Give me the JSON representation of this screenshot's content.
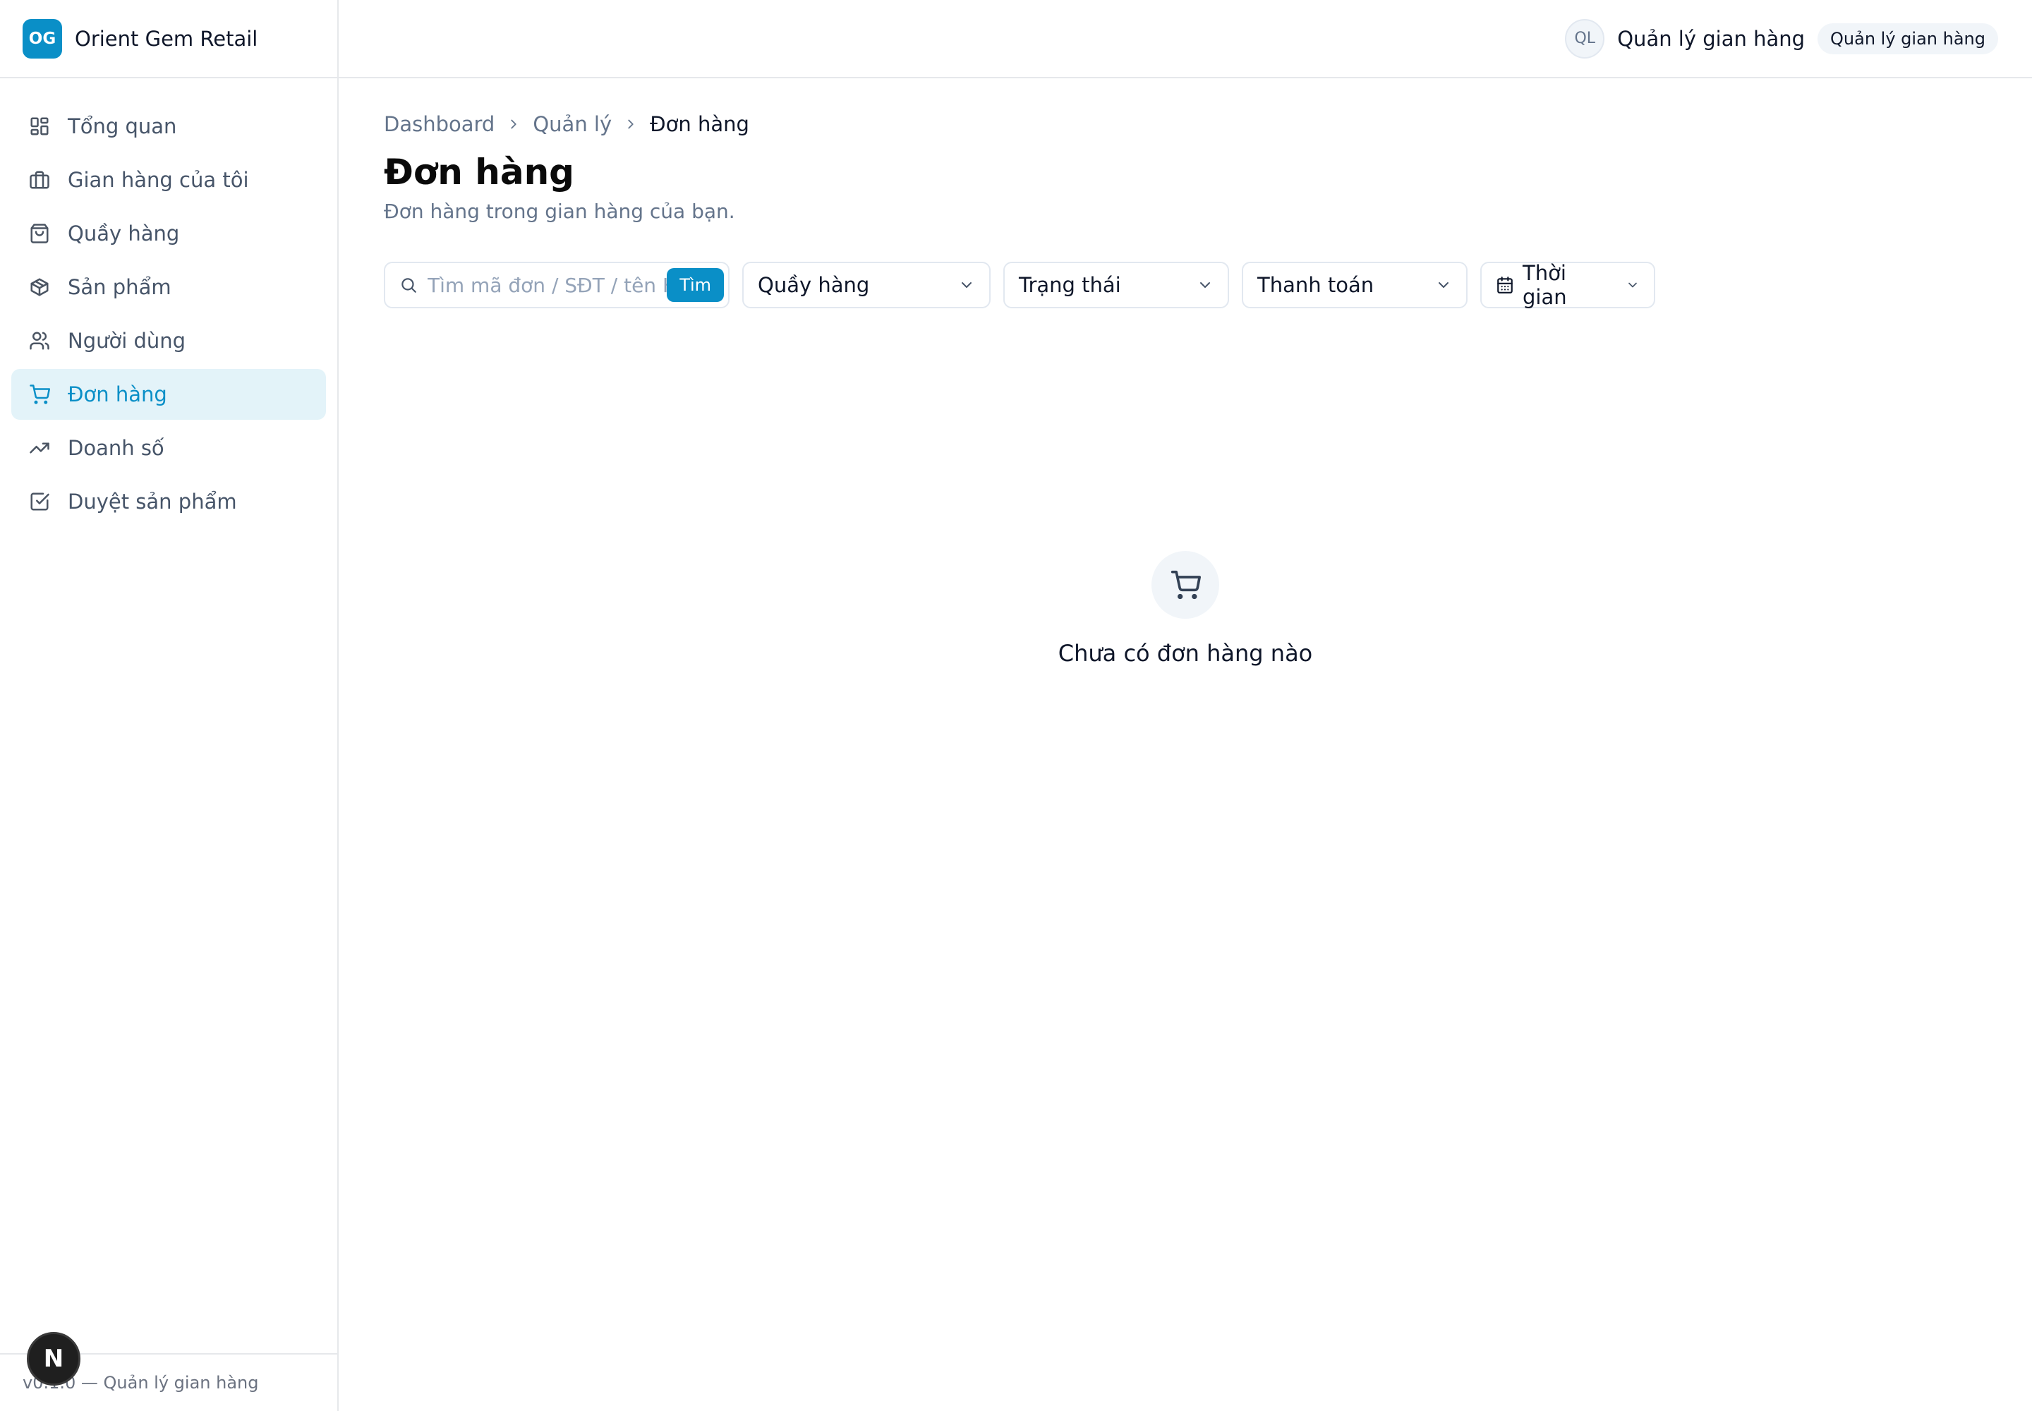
{
  "brand": {
    "logo_text": "OG",
    "name": "Orient Gem Retail"
  },
  "sidebar": {
    "items": [
      {
        "label": "Tổng quan",
        "icon": "dashboard-grid-icon",
        "active": false
      },
      {
        "label": "Gian hàng của tôi",
        "icon": "briefcase-icon",
        "active": false
      },
      {
        "label": "Quầy hàng",
        "icon": "shopping-bag-icon",
        "active": false
      },
      {
        "label": "Sản phẩm",
        "icon": "package-icon",
        "active": false
      },
      {
        "label": "Người dùng",
        "icon": "users-icon",
        "active": false
      },
      {
        "label": "Đơn hàng",
        "icon": "cart-icon",
        "active": true
      },
      {
        "label": "Doanh số",
        "icon": "trending-up-icon",
        "active": false
      },
      {
        "label": "Duyệt sản phẩm",
        "icon": "check-square-icon",
        "active": false
      }
    ],
    "footer": "v0.1.0 — Quản lý gian hàng"
  },
  "header": {
    "avatar_initials": "QL",
    "user_name": "Quản lý gian hàng",
    "role_badge": "Quản lý gian hàng"
  },
  "breadcrumb": {
    "items": [
      "Dashboard",
      "Quản lý",
      "Đơn hàng"
    ]
  },
  "page": {
    "title": "Đơn hàng",
    "subtitle": "Đơn hàng trong gian hàng của bạn."
  },
  "filters": {
    "search_placeholder": "Tìm mã đơn / SĐT / tên KH",
    "search_button": "Tìm",
    "counter_select": "Quầy hàng",
    "status_select": "Trạng thái",
    "payment_select": "Thanh toán",
    "time_select": "Thời gian"
  },
  "empty_state": {
    "icon": "cart-icon",
    "message": "Chưa có đơn hàng nào"
  },
  "dev_badge": {
    "letter": "N"
  },
  "colors": {
    "accent": "#0a8fc7",
    "active_bg": "#e3f3f9",
    "border": "#e2e8f0",
    "muted_text": "#64748b"
  }
}
